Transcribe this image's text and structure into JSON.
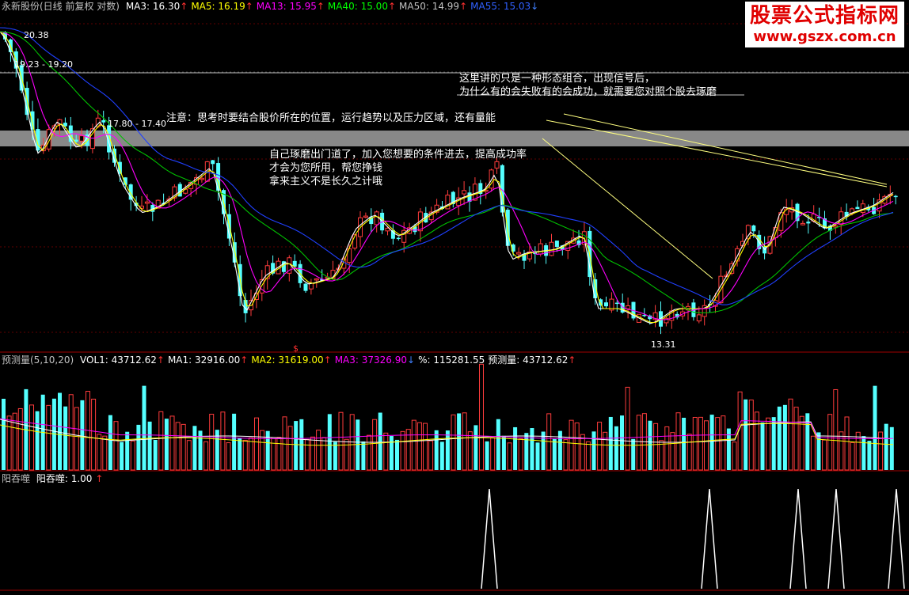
{
  "header": {
    "stock": "永新股份(日线 前复权 对数)",
    "ma": [
      {
        "label": "MA3: 16.30",
        "dir": "↑",
        "color": "#ffffff"
      },
      {
        "label": "MA5: 16.19",
        "dir": "↑",
        "color": "#ffff00"
      },
      {
        "label": "MA13: 15.95",
        "dir": "↑",
        "color": "#ff00ff"
      },
      {
        "label": "MA40: 15.00",
        "dir": "↑",
        "color": "#00ff00"
      },
      {
        "label": "MA50: 14.99",
        "dir": "↑",
        "color": "#c0c0c0"
      },
      {
        "label": "MA55: 15.03",
        "dir": "↓",
        "color": "#3060ff"
      }
    ]
  },
  "watermark": {
    "line1": "股票公式指标网",
    "line2": "www.gszx.com.cn"
  },
  "annotations": {
    "box_line1": "这里讲的只是一种形态组合，出现信号后，",
    "box_line2": "为什么有的会失败有的会成功，就需要您对照个股去琢磨",
    "note1": "注意：思考时要结合股价所在的位置，运行趋势以及压力区域，还有量能",
    "note2a": "自己琢磨出门道了，加入您想要的条件进去，提高成功率",
    "note2b": "才会为您所用，帮您挣钱",
    "note2c": "拿来主义不是长久之计哦"
  },
  "price_labels": {
    "p1": "20.38",
    "p2": "19.23 - 19.20",
    "p3": "17.80 - 17.40",
    "p4": "13.31"
  },
  "volume_header": {
    "name": "预测量(5,10,20)",
    "items": [
      {
        "label": "VOL1: 43712.62",
        "dir": "↑",
        "color": "#ffffff"
      },
      {
        "label": "MA1: 32916.00",
        "dir": "↑",
        "color": "#ffffff"
      },
      {
        "label": "MA2: 31619.00",
        "dir": "↑",
        "color": "#ffff00"
      },
      {
        "label": "MA3: 37326.90",
        "dir": "↓",
        "color": "#ff00ff"
      },
      {
        "label": "%: 115281.55",
        "dir": "",
        "color": "#ffffff"
      },
      {
        "label": "预测量: 43712.62",
        "dir": "↑",
        "color": "#ffffff"
      }
    ]
  },
  "signal_header": {
    "name": "阳吞噬",
    "item": "阳吞噬: 1.00",
    "dir": "↑"
  },
  "chart_data": [
    {
      "type": "candlestick",
      "title": "永新股份(日线 前复权 对数)",
      "price_range": [
        13.31,
        20.38
      ],
      "series": [
        {
          "name": "MA3",
          "value": 16.3
        },
        {
          "name": "MA5",
          "value": 16.19
        },
        {
          "name": "MA13",
          "value": 15.95
        },
        {
          "name": "MA40",
          "value": 15.0
        },
        {
          "name": "MA50",
          "value": 14.99
        },
        {
          "name": "MA55",
          "value": 15.03
        }
      ],
      "marked_prices": [
        20.38,
        19.23,
        19.2,
        17.8,
        17.4,
        13.31
      ],
      "grid": true
    },
    {
      "type": "bar",
      "title": "预测量(5,10,20)",
      "series": [
        {
          "name": "VOL1",
          "value": 43712.62
        },
        {
          "name": "MA1",
          "value": 32916.0
        },
        {
          "name": "MA2",
          "value": 31619.0
        },
        {
          "name": "MA3",
          "value": 37326.9
        },
        {
          "name": "预测量",
          "value": 43712.62
        }
      ]
    },
    {
      "type": "line",
      "title": "阳吞噬",
      "series": [
        {
          "name": "阳吞噬",
          "value": 1.0
        }
      ]
    }
  ]
}
